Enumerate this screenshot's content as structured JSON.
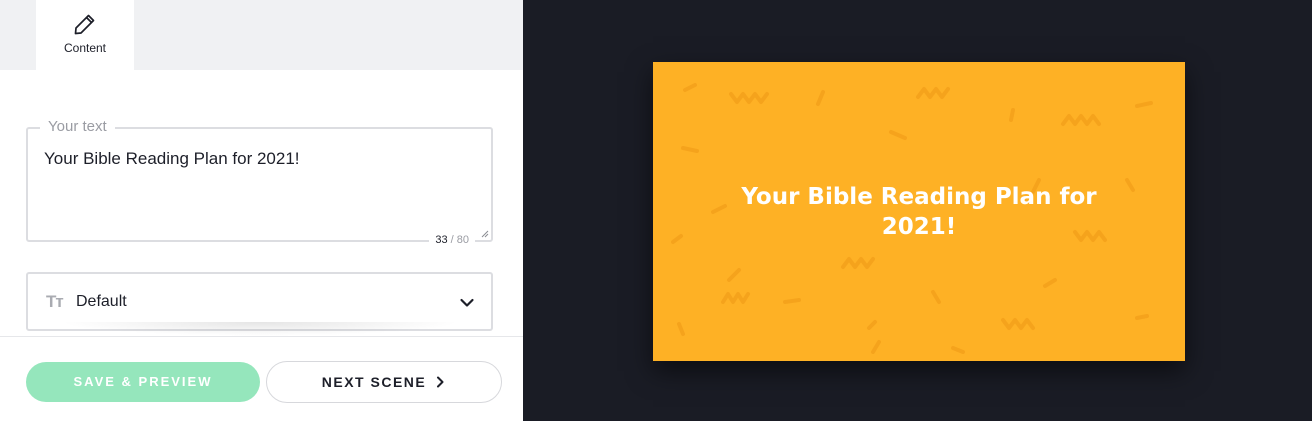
{
  "tabs": [
    {
      "label": "Content",
      "icon": "pencil-icon",
      "active": true
    }
  ],
  "text_field": {
    "legend": "Your text",
    "value": "Your Bible Reading Plan for 2021!",
    "count": "33",
    "max": "/ 80"
  },
  "font_select": {
    "icon": "text-size-icon",
    "icon_glyph": "Tт",
    "value": "Default"
  },
  "footer": {
    "save_label": "SAVE & PREVIEW",
    "next_label": "NEXT SCENE"
  },
  "preview": {
    "title": "Your Bible Reading Plan for 2021!"
  },
  "colors": {
    "scene_background": "#feb125",
    "confetti": "#f9a51a",
    "save_button": "#95e6bc",
    "preview_background": "#1a1c25"
  }
}
